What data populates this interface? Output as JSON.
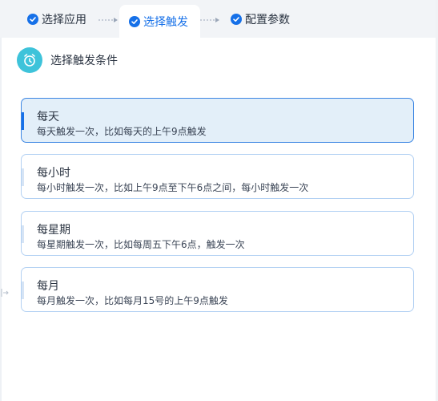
{
  "steps": [
    {
      "label": "选择应用",
      "state": "done"
    },
    {
      "label": "选择触发",
      "state": "active"
    },
    {
      "label": "配置参数",
      "state": "pending"
    }
  ],
  "header": {
    "title": "选择触发条件",
    "icon": "alarm-clock-icon"
  },
  "options": [
    {
      "title": "每天",
      "desc": "每天触发一次，比如每天的上午9点触发",
      "selected": true
    },
    {
      "title": "每小时",
      "desc": "每小时触发一次，比如上午9点至下午6点之间，每小时触发一次",
      "selected": false
    },
    {
      "title": "每星期",
      "desc": "每星期触发一次，比如每周五下午6点，触发一次",
      "selected": false
    },
    {
      "title": "每月",
      "desc": "每月触发一次，比如每月15号的上午9点触发",
      "selected": false
    }
  ],
  "colors": {
    "accent": "#1670e8",
    "teal": "#3ec3da",
    "selected_bg": "#e3eff9"
  }
}
